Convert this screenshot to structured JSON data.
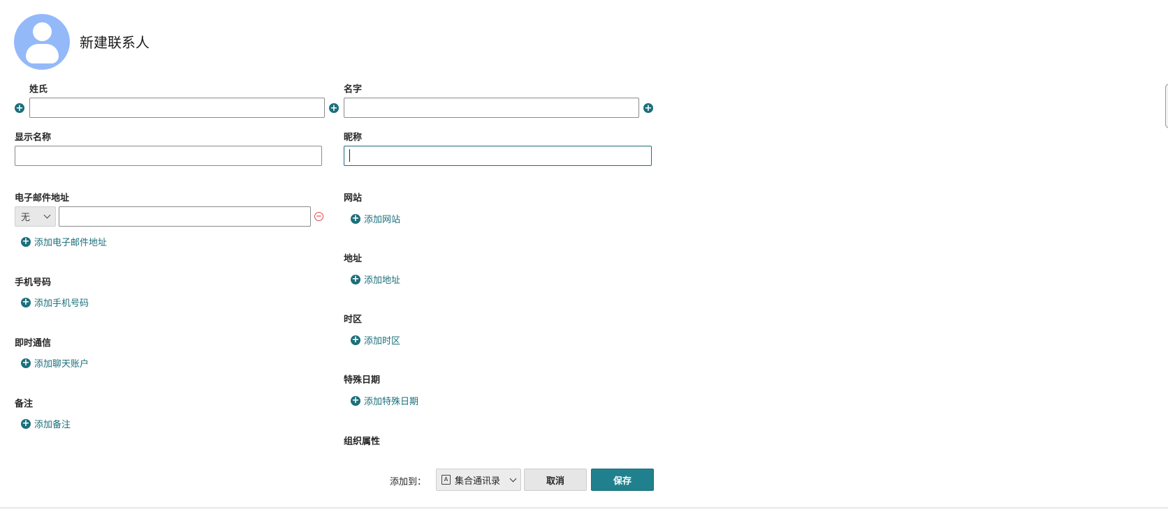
{
  "header": {
    "title": "新建联系人"
  },
  "name_fields": {
    "surname_label": "姓氏",
    "given_label": "名字",
    "display_label": "显示名称",
    "nickname_label": "昵称",
    "surname_value": "",
    "given_value": "",
    "display_value": "",
    "nickname_value": ""
  },
  "email": {
    "label": "电子邮件地址",
    "type_value": "无",
    "value": "",
    "add_label": "添加电子邮件地址"
  },
  "website": {
    "label": "网站",
    "add_label": "添加网站"
  },
  "address": {
    "label": "地址",
    "add_label": "添加地址"
  },
  "mobile": {
    "label": "手机号码",
    "add_label": "添加手机号码"
  },
  "timezone": {
    "label": "时区",
    "add_label": "添加时区"
  },
  "im": {
    "label": "即时通信",
    "add_label": "添加聊天账户"
  },
  "special_dates": {
    "label": "特殊日期",
    "add_label": "添加特殊日期"
  },
  "notes": {
    "label": "备注",
    "add_label": "添加备注"
  },
  "org": {
    "label": "组织属性"
  },
  "footer": {
    "add_to_label": "添加到：",
    "book_value": "集合通讯录",
    "book_icon": "A",
    "cancel_label": "取消",
    "save_label": "保存"
  },
  "colors": {
    "accent": "#21808d",
    "link": "#1b6f7b",
    "avatar": "#93b9f9",
    "remove": "#e04646"
  }
}
